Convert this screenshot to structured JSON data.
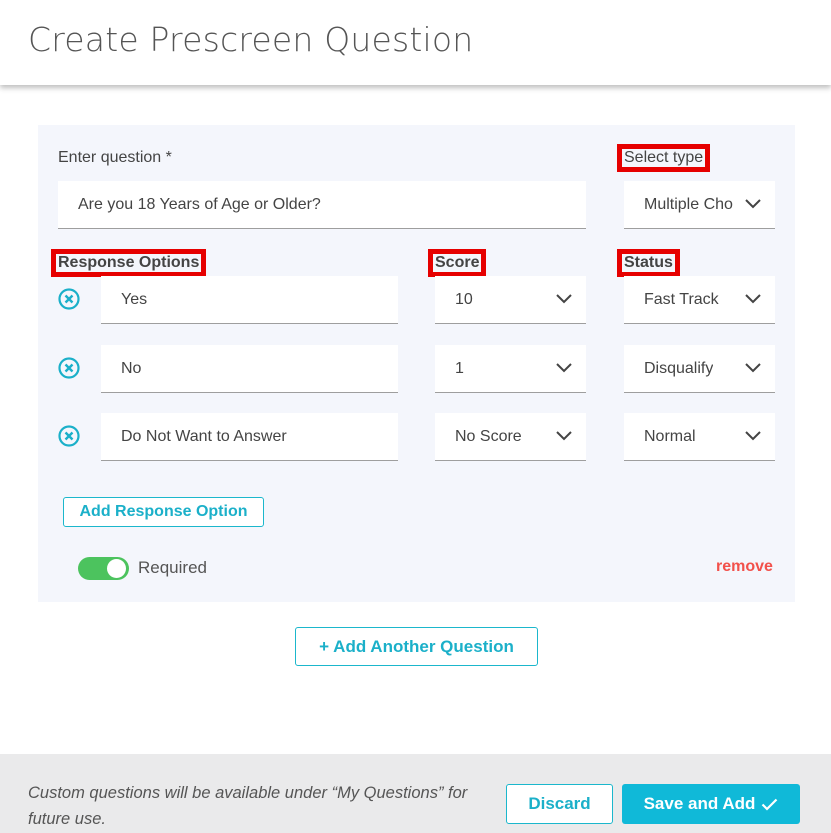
{
  "page": {
    "title": "Create Prescreen Question"
  },
  "question": {
    "label": "Enter question *",
    "value": "Are you 18 Years of Age or Older?",
    "type_label": "Select type",
    "type_value": "Multiple Cho"
  },
  "columns": {
    "response": "Response Options",
    "score": "Score",
    "status": "Status"
  },
  "rows": [
    {
      "option": "Yes",
      "score": "10",
      "status": "Fast Track"
    },
    {
      "option": "No",
      "score": "1",
      "status": "Disqualify"
    },
    {
      "option": "Do Not Want to Answer",
      "score": "No Score",
      "status": "Normal"
    }
  ],
  "actions": {
    "add_response": "Add Response Option",
    "required": "Required",
    "remove": "remove",
    "add_question": "+ Add Another Question"
  },
  "footer": {
    "note": "Custom questions will be available under “My Questions” for future use.",
    "discard": "Discard",
    "save": "Save and Add"
  },
  "colors": {
    "accent": "#1bb7cc",
    "primary_button": "#10b9d8",
    "toggle_on": "#4cc35e",
    "remove": "#f2514b",
    "highlight_box": "#e60000"
  },
  "state": {
    "required_toggle": true
  }
}
